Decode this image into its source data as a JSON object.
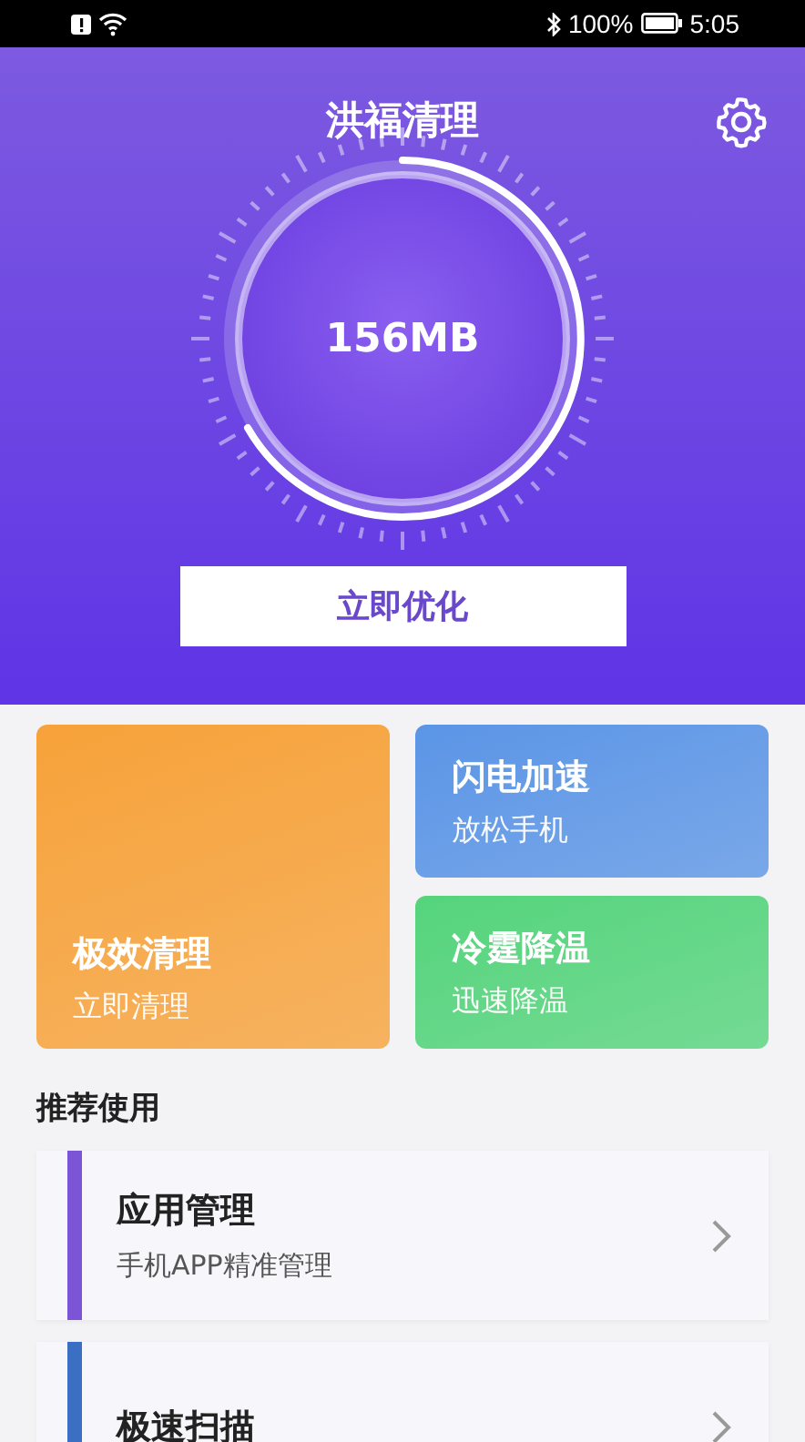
{
  "status_bar": {
    "battery": "100%",
    "time": "5:05"
  },
  "header": {
    "title": "洪福清理",
    "storage": "156MB",
    "button": "立即优化"
  },
  "tiles": [
    {
      "kind": "large",
      "title": "极效清理",
      "subtitle": "立即清理",
      "color": "#f7a23a"
    },
    {
      "kind": "small",
      "title": "闪电加速",
      "subtitle": "放松手机",
      "color": "#5b95e6"
    },
    {
      "kind": "small",
      "title": "冷霆降温",
      "subtitle": "迅速降温",
      "color": "#55d47c"
    }
  ],
  "section_title": "推荐使用",
  "recommendations": [
    {
      "title": "应用管理",
      "subtitle": "手机APP精准管理",
      "color": "#7b55d6"
    },
    {
      "title": "极速扫描",
      "color": "#3a6fc4"
    }
  ]
}
